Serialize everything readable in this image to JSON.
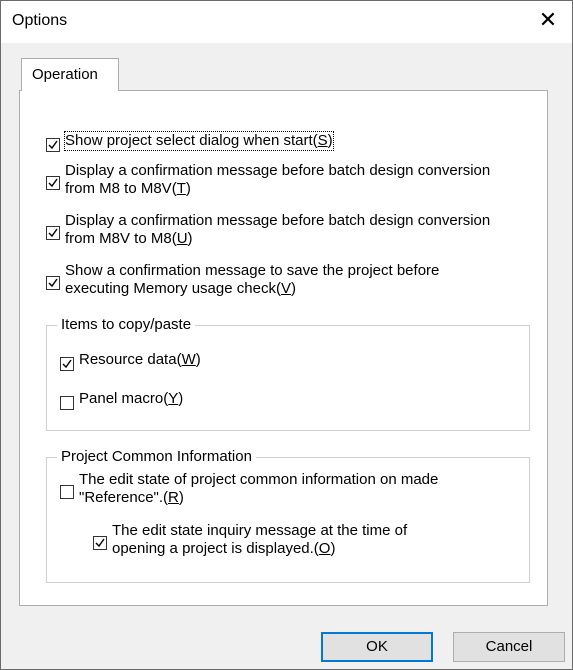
{
  "window": {
    "title": "Options",
    "close_glyph": "✕"
  },
  "tabs": [
    {
      "label": "Operation",
      "selected": true
    }
  ],
  "options": [
    {
      "label": "Show project select dialog when start",
      "mnemonic": "S",
      "checked": true
    },
    {
      "label_line1": "Display a confirmation message before batch design conversion",
      "label_line2": "from M8 to M8V",
      "mnemonic": "T",
      "checked": true
    },
    {
      "label_line1": "Display a confirmation message before batch design conversion",
      "label_line2": "from M8V to M8",
      "mnemonic": "U",
      "checked": true
    },
    {
      "label_line1": "Show a confirmation message to save the project before",
      "label_line2": "executing Memory usage check",
      "mnemonic": "V",
      "checked": true
    }
  ],
  "copy_group": {
    "title": "Items to copy/paste",
    "items": [
      {
        "label": "Resource data",
        "mnemonic": "W",
        "checked": true
      },
      {
        "label": "Panel macro",
        "mnemonic": "Y",
        "checked": false
      }
    ]
  },
  "common_group": {
    "title": "Project Common Information",
    "items": [
      {
        "label_line1": "The edit state of project common information on made",
        "label_line2": "\"Reference\".",
        "mnemonic": "R",
        "checked": false
      },
      {
        "label_line1": "The edit state inquiry message at the time of",
        "label_line2": "opening a project is displayed.",
        "mnemonic": "O",
        "checked": true
      }
    ]
  },
  "buttons": {
    "ok": "OK",
    "cancel": "Cancel"
  },
  "colors": {
    "dialog_bg": "#f0f0f0",
    "panel_bg": "#ffffff",
    "default_button_border": "#0078d7"
  }
}
